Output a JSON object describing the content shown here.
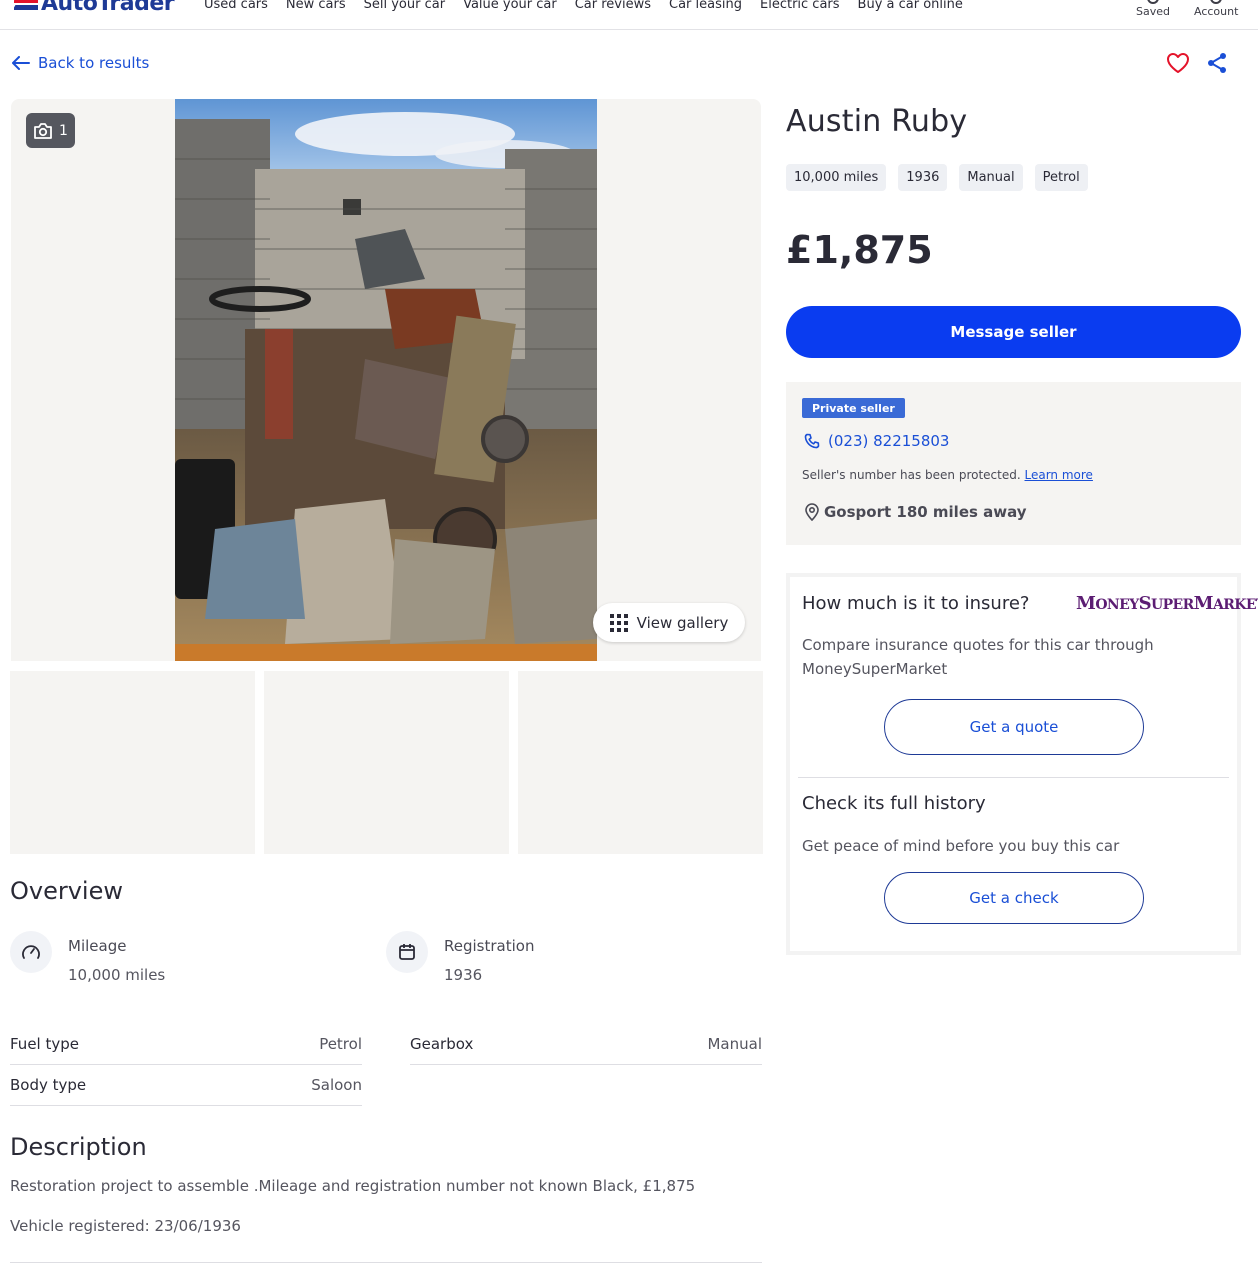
{
  "nav": {
    "logo_text": "AutoTrader",
    "links": [
      "Used cars",
      "New cars",
      "Sell your car",
      "Value your car",
      "Car reviews",
      "Car leasing",
      "Electric cars",
      "Buy a car online"
    ],
    "saved_label": "Saved",
    "account_label": "Account"
  },
  "back_label": "Back to results",
  "gallery": {
    "photo_count": "1",
    "view_gallery_label": "View gallery"
  },
  "listing": {
    "title": "Austin Ruby",
    "chips": [
      "10,000 miles",
      "1936",
      "Manual",
      "Petrol"
    ],
    "price": "£1,875",
    "message_button": "Message seller"
  },
  "seller": {
    "badge": "Private seller",
    "phone": "(023) 82215803",
    "protected_text": "Seller's number has been protected.",
    "learn_more": "Learn more",
    "location": "Gosport 180 miles away"
  },
  "insurance": {
    "heading": "How much is it to insure?",
    "brand": "MoneySuperMarket",
    "text": "Compare insurance quotes for this car through MoneySuperMarket",
    "button": "Get a quote"
  },
  "history": {
    "heading": "Check its full history",
    "text": "Get peace of mind before you buy this car",
    "button": "Get a check"
  },
  "overview": {
    "heading": "Overview",
    "mileage_label": "Mileage",
    "mileage_value": "10,000 miles",
    "registration_label": "Registration",
    "registration_value": "1936",
    "specs": [
      {
        "key": "Fuel type",
        "value": "Petrol"
      },
      {
        "key": "Gearbox",
        "value": "Manual"
      },
      {
        "key": "Body type",
        "value": "Saloon"
      }
    ]
  },
  "description": {
    "heading": "Description",
    "text": "Restoration project to assemble .Mileage and registration number not known Black, £1,875",
    "registered": "Vehicle registered: 23/06/1936"
  },
  "colors": {
    "brand_blue": "#0a3cf0",
    "link_blue": "#1a4fd6",
    "logo_red": "#e4132a",
    "msm_purple": "#5c1d73"
  }
}
